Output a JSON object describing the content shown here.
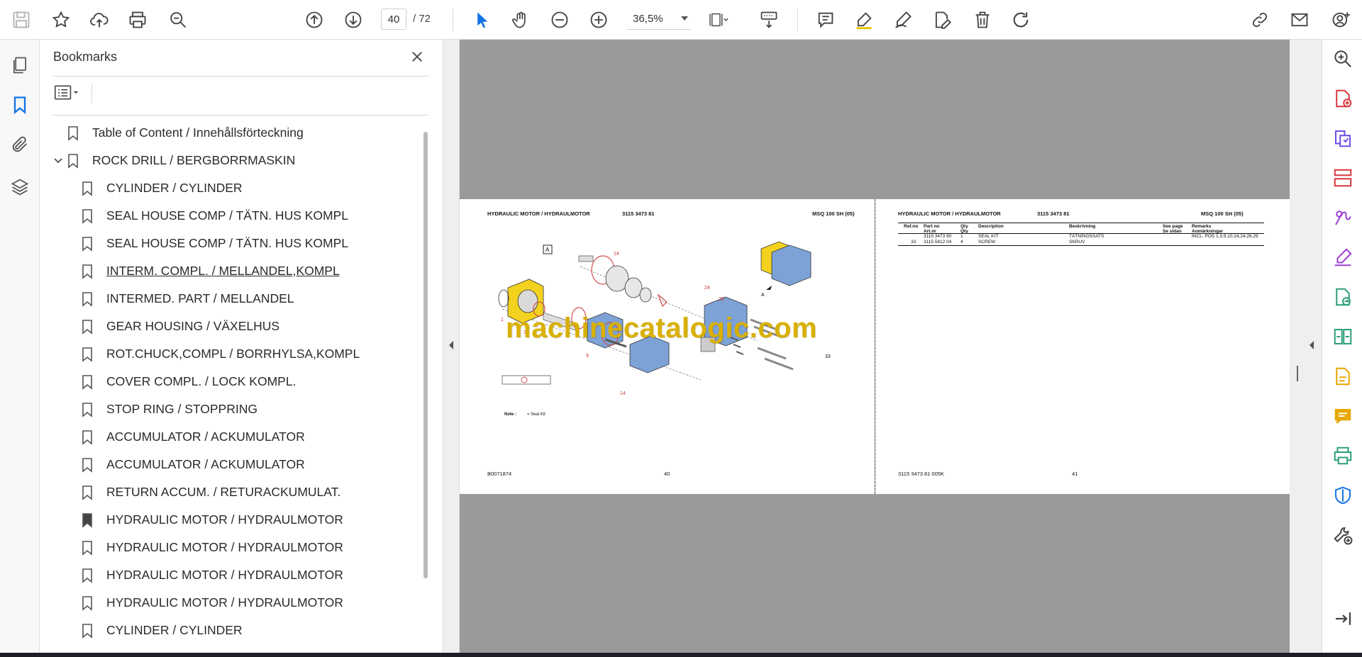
{
  "toolbar": {
    "page_current": "40",
    "page_total": "/ 72",
    "zoom": "36,5%",
    "icons": [
      "save-icon",
      "bookmark-star-icon",
      "upload-cloud-icon",
      "print-icon",
      "search-zoom-icon",
      "page-up-icon",
      "page-down-icon",
      "select-cursor-icon",
      "hand-tool-icon",
      "zoom-out-icon",
      "zoom-in-icon",
      "page-fit-icon",
      "scroll-mode-icon",
      "comment-icon",
      "highlight-icon",
      "draw-icon",
      "edit-text-icon",
      "delete-icon",
      "rotate-icon",
      "share-link-icon",
      "email-icon",
      "account-icon"
    ]
  },
  "left_rail": {
    "icons": [
      "pages-thumbnails-icon",
      "bookmarks-icon",
      "attachments-icon",
      "layers-icon"
    ]
  },
  "bookmarks": {
    "title": "Bookmarks",
    "items": [
      {
        "label": "Table of Content / Innehållsförteckning",
        "level": 0
      },
      {
        "label": "ROCK DRILL / BERGBORRMASKIN",
        "level": 0,
        "expanded": true
      },
      {
        "label": "CYLINDER / CYLINDER",
        "level": 1
      },
      {
        "label": "SEAL HOUSE COMP  / TÄTN. HUS KOMPL",
        "level": 1
      },
      {
        "label": "SEAL HOUSE COMP  / TÄTN. HUS KOMPL",
        "level": 1
      },
      {
        "label": "INTERM. COMPL. / MELLANDEL,KOMPL ",
        "level": 1,
        "underlined": true
      },
      {
        "label": "INTERMED. PART / MELLANDEL",
        "level": 1
      },
      {
        "label": "GEAR HOUSING / VÄXELHUS",
        "level": 1
      },
      {
        "label": "ROT.CHUCK,COMPL  / BORRHYLSA,KOMPL",
        "level": 1
      },
      {
        "label": "COVER COMPL. / LOCK KOMPL.",
        "level": 1
      },
      {
        "label": "STOP RING / STOPPRING",
        "level": 1
      },
      {
        "label": "ACCUMULATOR / ACKUMULATOR",
        "level": 1
      },
      {
        "label": "ACCUMULATOR / ACKUMULATOR",
        "level": 1
      },
      {
        "label": "RETURN ACCUM. / RETURACKUMULAT.",
        "level": 1
      },
      {
        "label": "HYDRAULIC MOTOR  / HYDRAULMOTOR",
        "level": 1,
        "active": true
      },
      {
        "label": "HYDRAULIC MOTOR  / HYDRAULMOTOR",
        "level": 1
      },
      {
        "label": "HYDRAULIC MOTOR  / HYDRAULMOTOR",
        "level": 1
      },
      {
        "label": "HYDRAULIC MOTOR  / HYDRAULMOTOR",
        "level": 1
      },
      {
        "label": "CYLINDER / CYLINDER",
        "level": 1
      }
    ]
  },
  "document": {
    "watermark": "machinecatalogic.com",
    "left_page": {
      "title": "HYDRAULIC MOTOR / HYDRAULMOTOR",
      "part": "3115 3473 81",
      "model": "MSQ 100 SH (05)",
      "footer_left": "B0071874",
      "page_no": "40",
      "callouts": [
        "A",
        "14",
        "24",
        "26",
        "1",
        "3",
        "9",
        "14",
        "33",
        "A"
      ],
      "note_label": "Note :",
      "note_text": "= Seal Kit"
    },
    "right_page": {
      "title": "HYDRAULIC MOTOR / HYDRAULMOTOR",
      "part": "3115 3473 81",
      "model": "MSQ 100 SH (05)",
      "footer_left": "3115 3473 81 005K",
      "page_no": "41",
      "table": {
        "headers": [
          [
            "Ref.no",
            ""
          ],
          [
            "Part no",
            "Art.nr"
          ],
          [
            "Qty",
            "Qty"
          ],
          [
            "Description",
            ""
          ],
          [
            "Beskrivning",
            ""
          ],
          [
            "See page",
            "Se sidan"
          ],
          [
            "Remarks",
            "Anmärkningar"
          ]
        ],
        "rows": [
          [
            "",
            "3115 3473 90",
            "1",
            "SEAL KIT",
            "TÄTNINGSSATS",
            "",
            "INCL. POS 1,3,9,10,14,24,26,29"
          ],
          [
            "33",
            "3115 5812 04",
            "4",
            "SCREW",
            "SKRUV",
            "",
            ""
          ]
        ]
      }
    }
  },
  "right_rail": {
    "icons": [
      "zoom-search-icon",
      "create-pdf-icon",
      "export-pdf-icon",
      "organize-pages-icon",
      "fill-sign-icon",
      "request-signature-icon",
      "edit-pdf-icon",
      "compare-icon",
      "combine-files-icon",
      "comment-tool-icon",
      "print-production-icon",
      "protect-icon",
      "more-tools-icon",
      "collapse-panel-icon"
    ]
  },
  "colors": {
    "accent_blue": "#1473e6",
    "doc_bg": "#9a9a9a",
    "watermark": "#d9b000",
    "tool_red": "#d7373f",
    "tool_purple": "#6e4ee6",
    "tool_green": "#2d9d78",
    "tool_yellow": "#e8a700"
  }
}
